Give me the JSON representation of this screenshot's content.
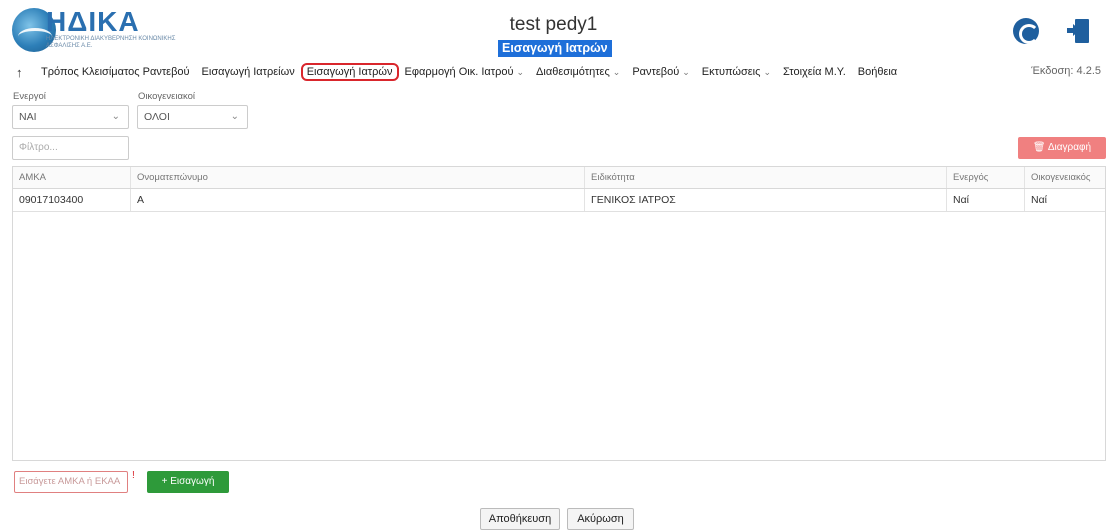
{
  "header": {
    "logo_text": "ΗΔΙΚΑ",
    "logo_sub": "ΗΛΕΚΤΡΟΝΙΚΗ ΔΙΑΚΥΒΕΡΝΗΣΗ ΚΟΙΝΩΝΙΚΗΣ ΑΣΦΑΛΙΣΗΣ Α.Ε.",
    "title": "test pedy1",
    "subtitle": "Εισαγωγή Ιατρών"
  },
  "menu": {
    "items": [
      {
        "label": "Τρόπος Κλεισίματος Ραντεβού"
      },
      {
        "label": "Εισαγωγή Ιατρείων"
      },
      {
        "label": "Εισαγωγή Ιατρών"
      },
      {
        "label": "Εφαρμογή Οικ. Ιατρού"
      },
      {
        "label": "Διαθεσιμότητες"
      },
      {
        "label": "Ραντεβού"
      },
      {
        "label": "Εκτυπώσεις"
      },
      {
        "label": "Στοιχεία Μ.Υ."
      },
      {
        "label": "Βοήθεια"
      }
    ],
    "version": "Έκδοση: 4.2.5"
  },
  "filters": {
    "active_label": "Ενεργοί",
    "active_value": "ΝΑΙ",
    "family_label": "Οικογενειακοί",
    "family_value": "ΟΛΟΙ",
    "search_placeholder": "Φίλτρο..."
  },
  "actions": {
    "delete_label": "Διαγραφή"
  },
  "table": {
    "headers": [
      "ΑΜΚΑ",
      "Ονοματεπώνυμο",
      "Ειδικότητα",
      "Ενεργός",
      "Οικογενειακός"
    ],
    "rows": [
      [
        "09017103400",
        "Α",
        "ΓΕΝΙΚΟΣ ΙΑΤΡΟΣ",
        "Ναί",
        "Ναί"
      ]
    ]
  },
  "bottom": {
    "amka_placeholder": "Εισάγετε ΑΜΚΑ ή ΕΚΑΑ",
    "required_mark": "!",
    "add_label": "+ Εισαγωγή",
    "save_label": "Αποθήκευση",
    "cancel_label": "Ακύρωση"
  },
  "colors": {
    "accent": "#1e6fd9",
    "delete": "#f08080",
    "add": "#2e9a3a",
    "highlight_border": "#d9262c"
  }
}
